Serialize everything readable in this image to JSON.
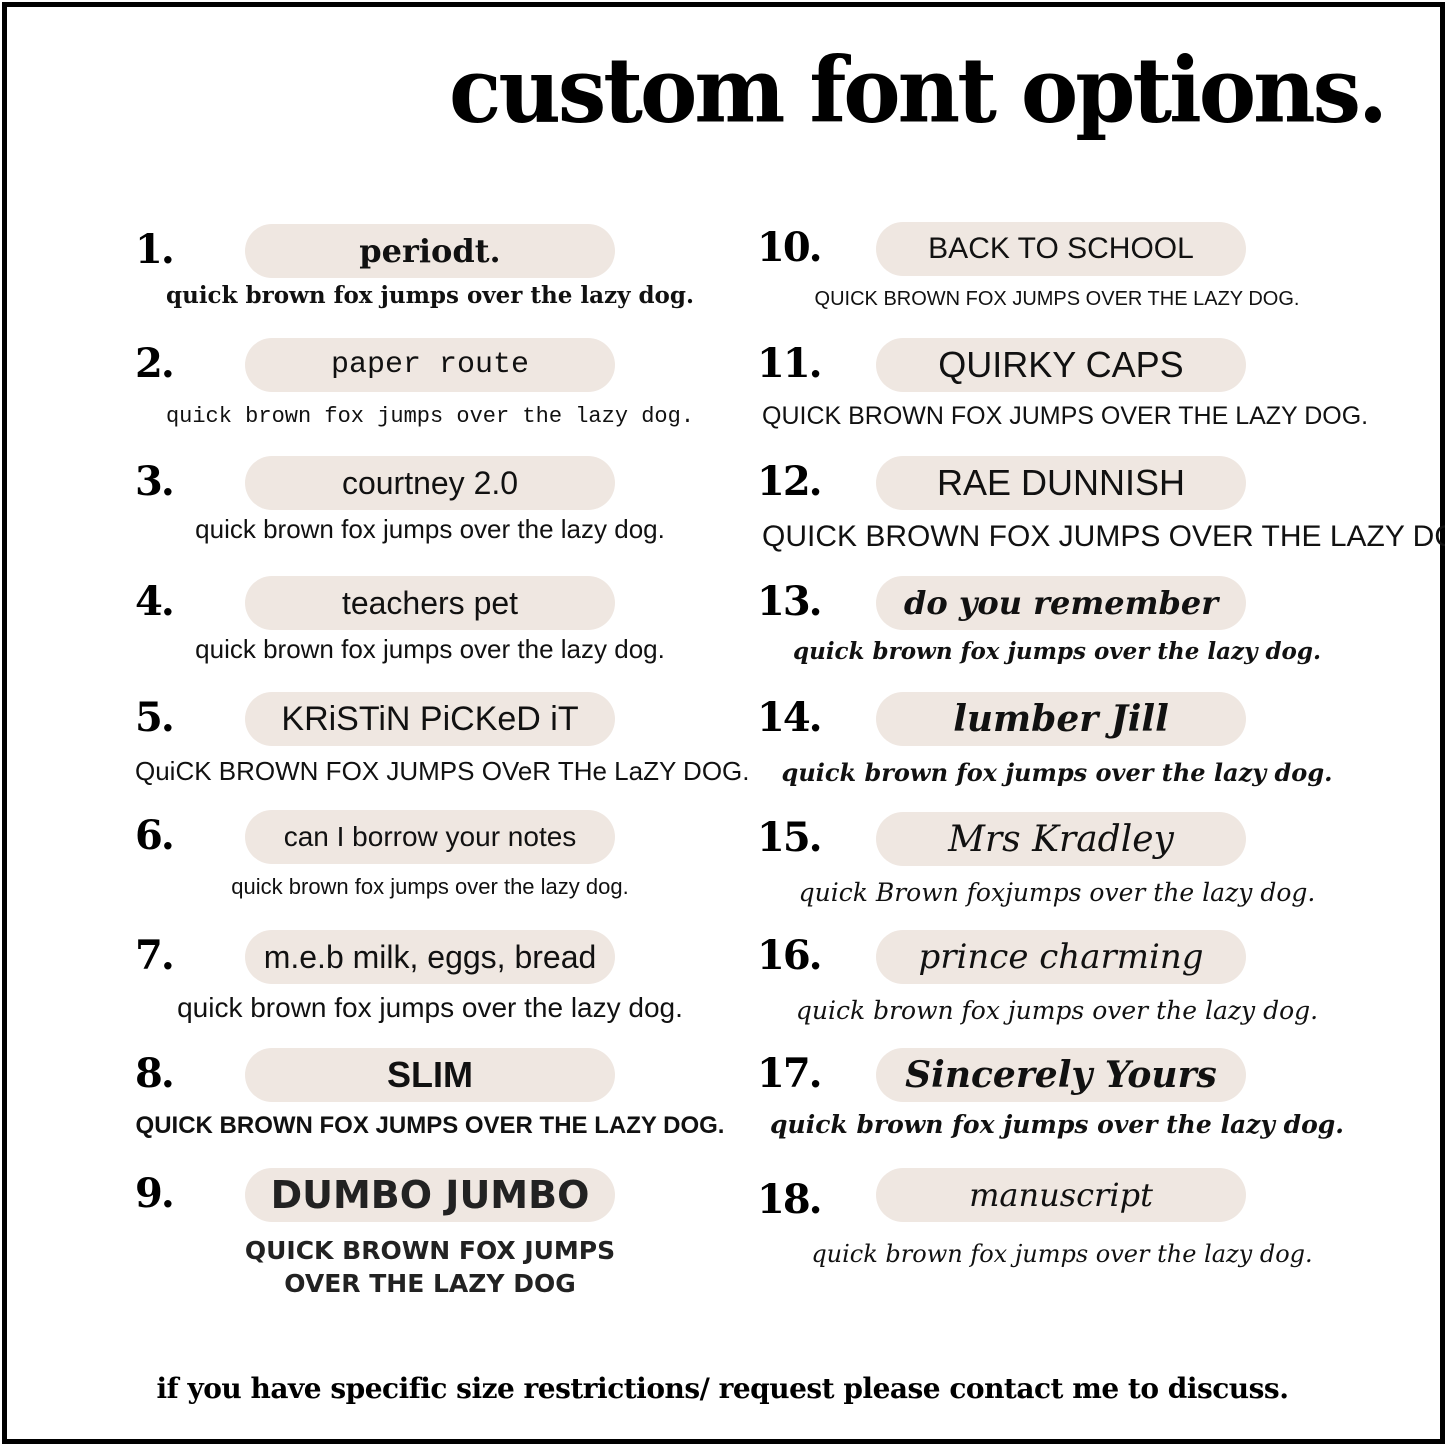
{
  "title": "custom font options.",
  "colors": {
    "pill_background": "#efe7e1",
    "text": "#111111",
    "border": "#000000"
  },
  "fonts_left": [
    {
      "number": "1.",
      "name": "periodt.",
      "sample": "quick brown fox jumps over the lazy dog."
    },
    {
      "number": "2.",
      "name": "paper route",
      "sample": "quick brown fox jumps over the lazy dog."
    },
    {
      "number": "3.",
      "name": "courtney 2.0",
      "sample": "quick brown fox jumps over the lazy dog."
    },
    {
      "number": "4.",
      "name": "teachers pet",
      "sample": "quick brown fox jumps over the lazy dog."
    },
    {
      "number": "5.",
      "name": "KRiSTiN PiCKeD iT",
      "sample": "QuiCK BROWN FOX JUMPS OVeR THe LaZY DOG."
    },
    {
      "number": "6.",
      "name": "can I borrow your notes",
      "sample": "quick brown fox jumps over the lazy dog."
    },
    {
      "number": "7.",
      "name": "m.e.b milk, eggs, bread",
      "sample": "quick brown fox jumps over the lazy dog."
    },
    {
      "number": "8.",
      "name": "SLIM",
      "sample": "QUICK BROWN FOX JUMPS OVER THE LAZY DOG."
    },
    {
      "number": "9.",
      "name": "DUMBO JUMBO",
      "sample": "QUICK BROWN FOX JUMPS",
      "sample_line2": "OVER THE LAZY DOG"
    }
  ],
  "fonts_right": [
    {
      "number": "10.",
      "name": "BACK TO SCHOOL",
      "sample": "QUICK BROWN FOX JUMPS OVER THE LAZY DOG."
    },
    {
      "number": "11.",
      "name": "QUIRKY CAPS",
      "sample": "QUICK BROWN FOX JUMPS OVER THE LAZY DOG."
    },
    {
      "number": "12.",
      "name": "RAE DUNNISH",
      "sample": "QUICK BROWN FOX JUMPS OVER THE LAZY DOG."
    },
    {
      "number": "13.",
      "name": "do you remember",
      "sample": "quick brown fox jumps over the lazy dog."
    },
    {
      "number": "14.",
      "name": "lumber Jill",
      "sample": "quick brown fox jumps over the lazy dog."
    },
    {
      "number": "15.",
      "name": "Mrs Kradley",
      "sample": "quick Brown foxjumps over the lazy dog."
    },
    {
      "number": "16.",
      "name": "prince charming",
      "sample": "quick brown fox jumps over the lazy dog."
    },
    {
      "number": "17.",
      "name": "Sincerely Yours",
      "sample": "quick brown fox jumps over the lazy dog."
    },
    {
      "number": "18.",
      "name": "manuscript",
      "sample": "quick brown fox jumps over the lazy dog."
    }
  ],
  "footer": "if you have specific size restrictions/ request please contact me to discuss."
}
